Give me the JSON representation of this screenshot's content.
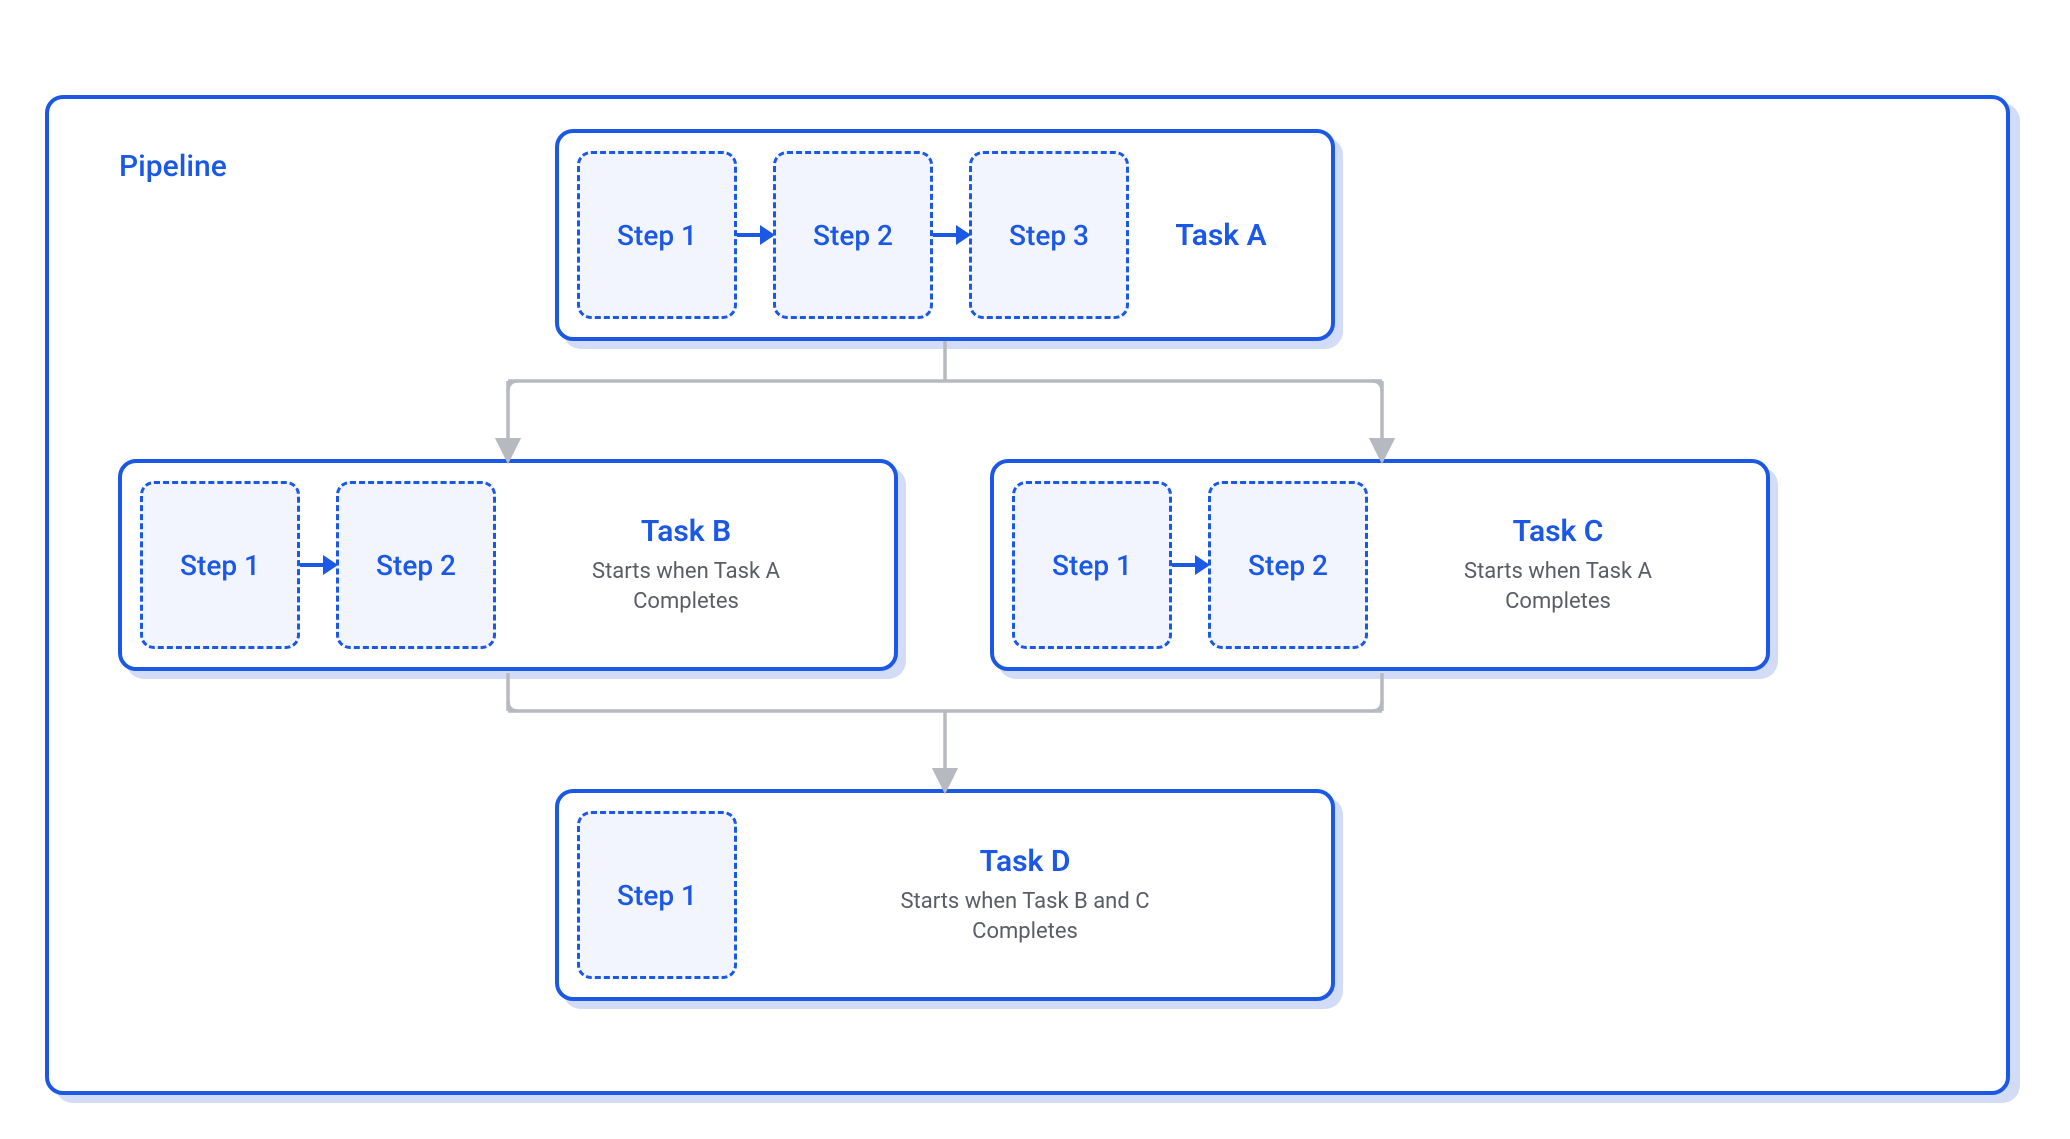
{
  "pipeline": {
    "label": "Pipeline",
    "tasks": {
      "A": {
        "title": "Task A",
        "subtitle": "",
        "steps": [
          "Step 1",
          "Step 2",
          "Step 3"
        ]
      },
      "B": {
        "title": "Task B",
        "subtitle": "Starts when Task A\nCompletes",
        "steps": [
          "Step 1",
          "Step 2"
        ]
      },
      "C": {
        "title": "Task C",
        "subtitle": "Starts when Task A\nCompletes",
        "steps": [
          "Step 1",
          "Step 2"
        ]
      },
      "D": {
        "title": "Task D",
        "subtitle": "Starts when Task B and C\nCompletes",
        "steps": [
          "Step 1"
        ]
      }
    },
    "edges": [
      {
        "from": "A",
        "to": "B"
      },
      {
        "from": "A",
        "to": "C"
      },
      {
        "from": "B",
        "to": "D"
      },
      {
        "from": "C",
        "to": "D"
      }
    ]
  },
  "colors": {
    "brand": "#1a58e5",
    "shadow": "#d2dcf6",
    "connector": "#b7b9c0",
    "subtext": "#5a5d66"
  }
}
